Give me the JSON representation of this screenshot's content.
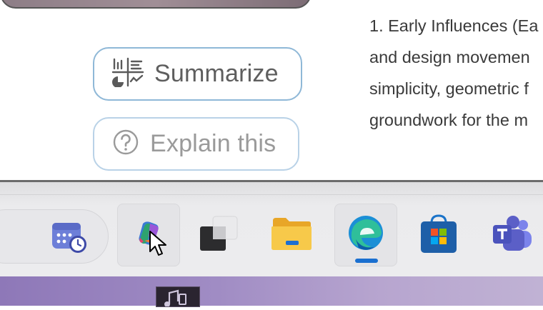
{
  "copilot_menu": {
    "summarize_label": "Summarize",
    "explain_label": "Explain this",
    "icons": {
      "summarize": "summarize-chart-icon",
      "explain": "question-circle-icon"
    }
  },
  "document": {
    "lines": [
      "1. Early Influences (Ea",
      "and design movemen",
      "simplicity, geometric f",
      "groundwork for the m"
    ]
  },
  "taskbar": {
    "widget_icon": "calendar-clock-icon",
    "apps": [
      {
        "name": "copilot",
        "icon": "copilot-icon",
        "active": false,
        "hovered": true
      },
      {
        "name": "task-view",
        "icon": "task-view-icon",
        "active": false
      },
      {
        "name": "file-explorer",
        "icon": "folder-icon",
        "active": false
      },
      {
        "name": "edge",
        "icon": "edge-icon",
        "active": true
      },
      {
        "name": "microsoft-store",
        "icon": "store-icon",
        "active": false
      },
      {
        "name": "teams",
        "icon": "teams-icon",
        "active": false
      }
    ]
  },
  "colors": {
    "accent": "#1a6fd0",
    "pill_border": "#8fb8d7",
    "taskbar_bg": "#ebebed"
  }
}
